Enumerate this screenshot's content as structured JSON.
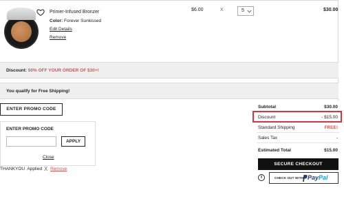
{
  "product": {
    "name": "Primer-Infused Bronzer",
    "color_label": "Color:",
    "color_value": "Forever Sunkissed",
    "edit_label": "Edit Details",
    "remove_label": "Remove",
    "price": "$6.00",
    "times": "X",
    "quantity": "5",
    "line_total": "$30.00",
    "wishlist_icon": "heart-icon"
  },
  "discount_bar": {
    "label": "Discount:",
    "offer": "50% OFF YOUR ORDER OF $30+!"
  },
  "shipping_bar": {
    "message": "You qualify for Free Shipping!"
  },
  "promo": {
    "toggle_label": "ENTER PROMO CODE",
    "panel_title": "ENTER PROMO CODE",
    "input_value": "",
    "apply_label": "APPLY",
    "close_label": "Close",
    "applied_code": "THANKYOU",
    "applied_status": "Applied",
    "remove_x": "X",
    "remove_label": "Remove"
  },
  "summary": {
    "subtotal_label": "Subtotal",
    "subtotal_value": "$30.00",
    "discount_label": "Discount",
    "discount_value": "- $15.00",
    "shipping_label": "Standard Shipping",
    "shipping_value": "FREE!",
    "tax_label": "Sales Tax",
    "tax_value": "-",
    "total_label": "Estimated Total",
    "total_value": "$15.00",
    "checkout_label": "SECURE CHECKOUT",
    "info_icon": "i",
    "paypal_prefix": "CHECK OUT WITH",
    "paypal_brand_1": "Pay",
    "paypal_brand_2": "Pal"
  },
  "colors": {
    "accent_red": "#d9534f",
    "highlight_border": "#d9343f",
    "checkout_bg": "#111111",
    "paypal_blue": "#253b80",
    "paypal_light": "#179bd7"
  }
}
